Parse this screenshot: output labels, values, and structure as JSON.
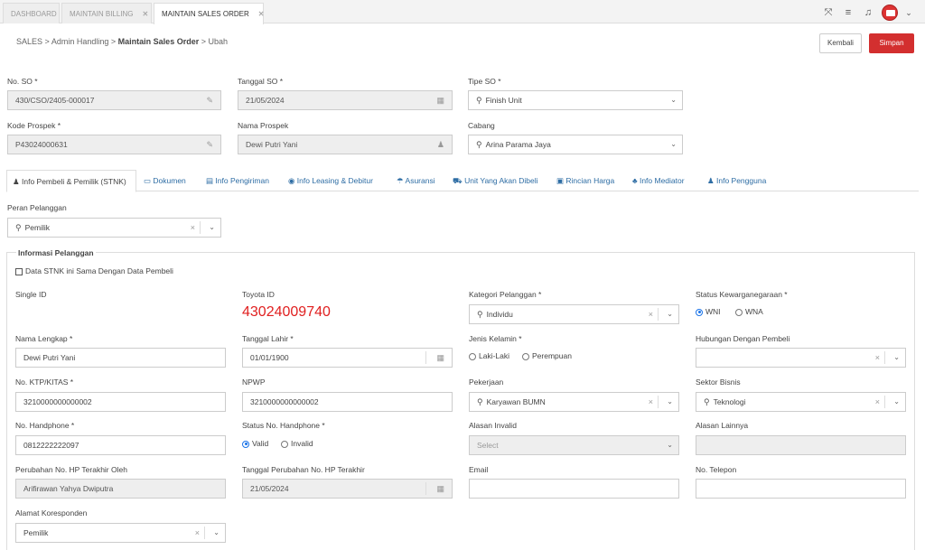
{
  "tabs": [
    {
      "label": "DASHBOARD"
    },
    {
      "label": "MAINTAIN BILLING",
      "close": "✕"
    },
    {
      "label": "MAINTAIN SALES ORDER",
      "close": "✕"
    }
  ],
  "breadcrumb": {
    "a": "SALES",
    "b": "Admin Handling",
    "c": "Maintain Sales Order",
    "d": "Ubah",
    "sep": ">"
  },
  "actions": {
    "kembali": "Kembali",
    "simpan": "Simpan"
  },
  "header": {
    "no_so_label": "No. SO *",
    "no_so": "430/CSO/2405-000017",
    "tanggal_so_label": "Tanggal SO *",
    "tanggal_so": "21/05/2024",
    "tipe_so_label": "Tipe SO *",
    "tipe_so": "Finish Unit",
    "kode_prospek_label": "Kode Prospek *",
    "kode_prospek": "P43024000631",
    "nama_prospek_label": "Nama Prospek",
    "nama_prospek": "Dewi Putri Yani",
    "cabang_label": "Cabang",
    "cabang": "Arina Parama Jaya"
  },
  "form_tabs": [
    {
      "icon": "♟",
      "label": "Info Pembeli & Pemilik (STNK)"
    },
    {
      "icon": "▭",
      "label": "Dokumen"
    },
    {
      "icon": "▤",
      "label": "Info Pengiriman"
    },
    {
      "icon": "◉",
      "label": "Info Leasing & Debitur"
    },
    {
      "icon": "☂",
      "label": "Asuransi"
    },
    {
      "icon": "⛟",
      "label": "Unit Yang Akan Dibeli"
    },
    {
      "icon": "▣",
      "label": "Rincian Harga"
    },
    {
      "icon": "♣",
      "label": "Info Mediator"
    },
    {
      "icon": "♟",
      "label": "Info Pengguna"
    }
  ],
  "peran": {
    "label": "Peran Pelanggan",
    "value": "Pemilik"
  },
  "info": {
    "legend": "Informasi Pelanggan",
    "checkbox": "Data STNK ini Sama Dengan Data Pembeli",
    "single_id_label": "Single ID",
    "toyota_id_label": "Toyota ID",
    "toyota_id": "43024009740",
    "kategori_label": "Kategori Pelanggan *",
    "kategori": "Individu",
    "status_label": "Status Kewarganegaraan *",
    "wni": "WNI",
    "wna": "WNA",
    "nama_label": "Nama Lengkap *",
    "nama": "Dewi Putri Yani",
    "tgl_lahir_label": "Tanggal Lahir *",
    "tgl_lahir": "01/01/1900",
    "jk_label": "Jenis Kelamin *",
    "laki": "Laki-Laki",
    "perempuan": "Perempuan",
    "hubungan_label": "Hubungan Dengan Pembeli",
    "ktp_label": "No. KTP/KITAS *",
    "ktp": "3210000000000002",
    "npwp_label": "NPWP",
    "npwp": "3210000000000002",
    "pekerjaan_label": "Pekerjaan",
    "pekerjaan": "Karyawan BUMN",
    "sektor_label": "Sektor Bisnis",
    "sektor": "Teknologi",
    "hp_label": "No. Handphone *",
    "hp": "0812222222097",
    "status_hp_label": "Status No. Handphone *",
    "valid": "Valid",
    "invalid": "Invalid",
    "alasan_invalid_label": "Alasan Invalid",
    "alasan_invalid_ph": "Select",
    "alasan_lain_label": "Alasan Lainnya",
    "perubahan_label": "Perubahan No. HP Terakhir Oleh",
    "perubahan": "Arifirawan Yahya Dwiputra",
    "tgl_perubahan_label": "Tanggal Perubahan No. HP Terakhir",
    "tgl_perubahan": "21/05/2024",
    "email_label": "Email",
    "telepon_label": "No. Telepon",
    "alamat_label": "Alamat Koresponden",
    "alamat": "Pemilik"
  },
  "icons": {
    "pencil": "✎",
    "calendar": "▦",
    "user": "♟",
    "search": "⚲",
    "chevron": "⌄",
    "clear": "×"
  }
}
